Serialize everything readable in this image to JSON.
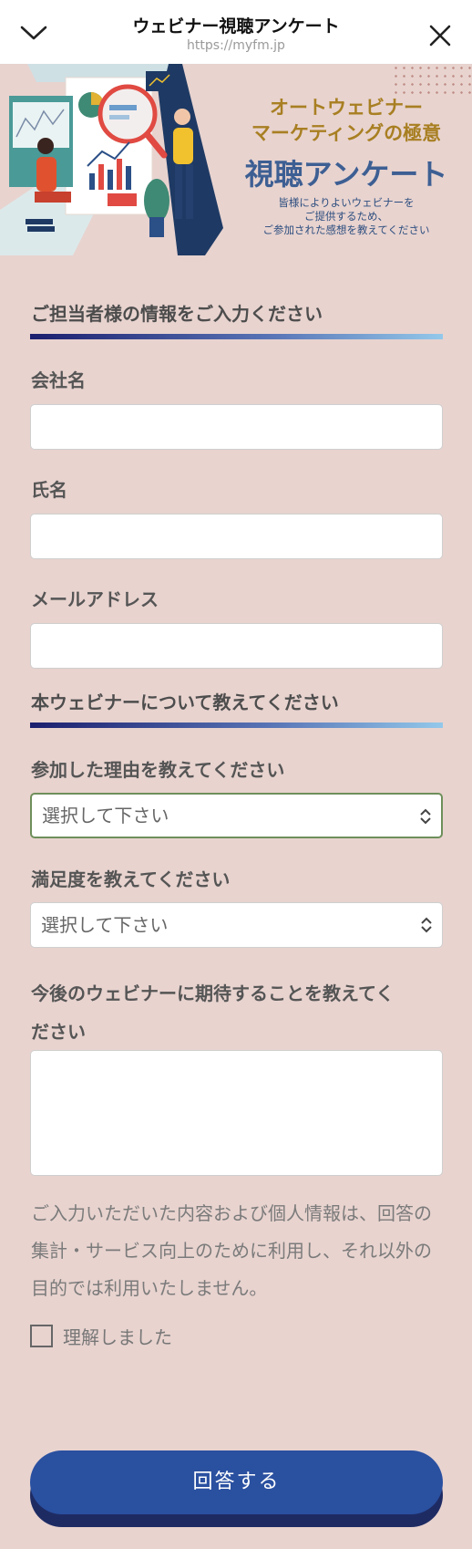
{
  "browser": {
    "title": "ウェビナー視聴アンケート",
    "url": "https://myfm.jp"
  },
  "banner": {
    "headline_line1": "オートウェビナー",
    "headline_line2": "マーケティングの極意",
    "main_title": "視聴アンケート",
    "sub_line1": "皆様によりよいウェビナーを",
    "sub_line2": "ご提供するため、",
    "sub_line3": "ご参加された感想を教えてください"
  },
  "section1": {
    "title": "ご担当者様の情報をご入力ください",
    "company_label": "会社名",
    "name_label": "氏名",
    "email_label": "メールアドレス"
  },
  "section2": {
    "title": "本ウェビナーについて教えてください",
    "reason_label": "参加した理由を教えてください",
    "reason_value": "選択して下さい",
    "satisfaction_label": "満足度を教えてください",
    "satisfaction_value": "選択して下さい",
    "expectation_label_line1": "今後のウェビナーに期待することを教えてく",
    "expectation_label_line2": "ださい"
  },
  "notice": {
    "text": "ご入力いただいた内容および個人情報は、回答の集計・サービス向上のために利用し、それ以外の目的では利用いたしません。"
  },
  "consent": {
    "label": "理解しました"
  },
  "submit": {
    "label": "回答する"
  },
  "colors": {
    "background": "#e8d3cf",
    "button": "#2a50a0",
    "accent_gold": "#a87f22",
    "accent_blue": "#3d5f93"
  }
}
